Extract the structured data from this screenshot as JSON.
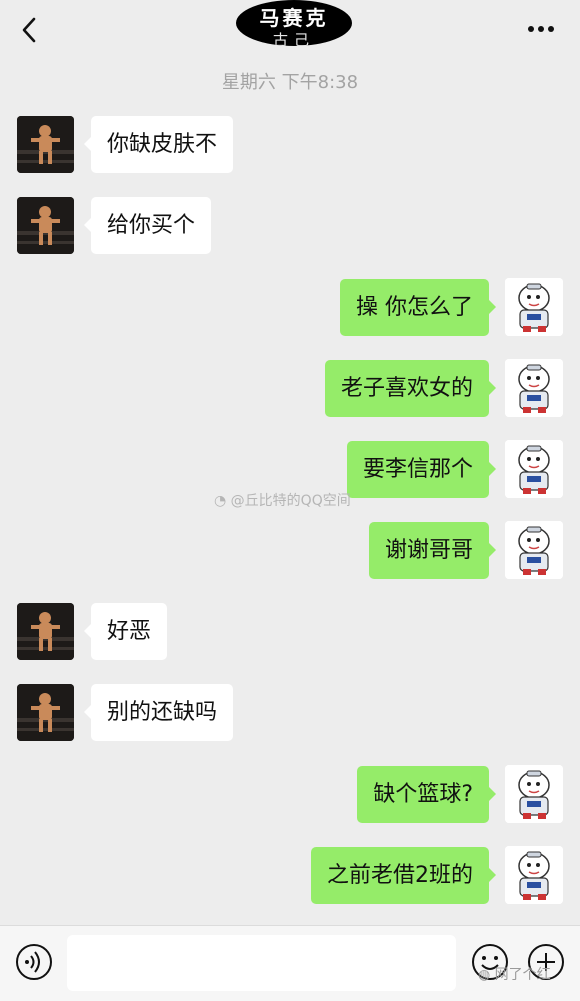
{
  "header": {
    "title_line1": "马赛克",
    "title_line2": "古己"
  },
  "timestamp": "星期六 下午8:38",
  "messages": [
    {
      "side": "in",
      "text": "你缺皮肤不"
    },
    {
      "side": "in",
      "text": "给你买个"
    },
    {
      "side": "out",
      "text": "操 你怎么了"
    },
    {
      "side": "out",
      "text": "老子喜欢女的"
    },
    {
      "side": "out",
      "text": "要李信那个"
    },
    {
      "side": "out",
      "text": "谢谢哥哥"
    },
    {
      "side": "in",
      "text": "好恶"
    },
    {
      "side": "in",
      "text": "别的还缺吗"
    },
    {
      "side": "out",
      "text": "缺个篮球?"
    },
    {
      "side": "out",
      "text": "之前老借2班的"
    }
  ],
  "watermark": "@丘比特的QQ空间",
  "corner_watermark": "网了个红",
  "icons": {
    "back": "chevron-left-icon",
    "more": "more-dots-icon",
    "voice": "voice-icon",
    "emoji": "emoji-icon",
    "plus": "plus-icon"
  },
  "colors": {
    "background": "#ededed",
    "outgoing_bubble": "#95ec69",
    "incoming_bubble": "#ffffff"
  }
}
